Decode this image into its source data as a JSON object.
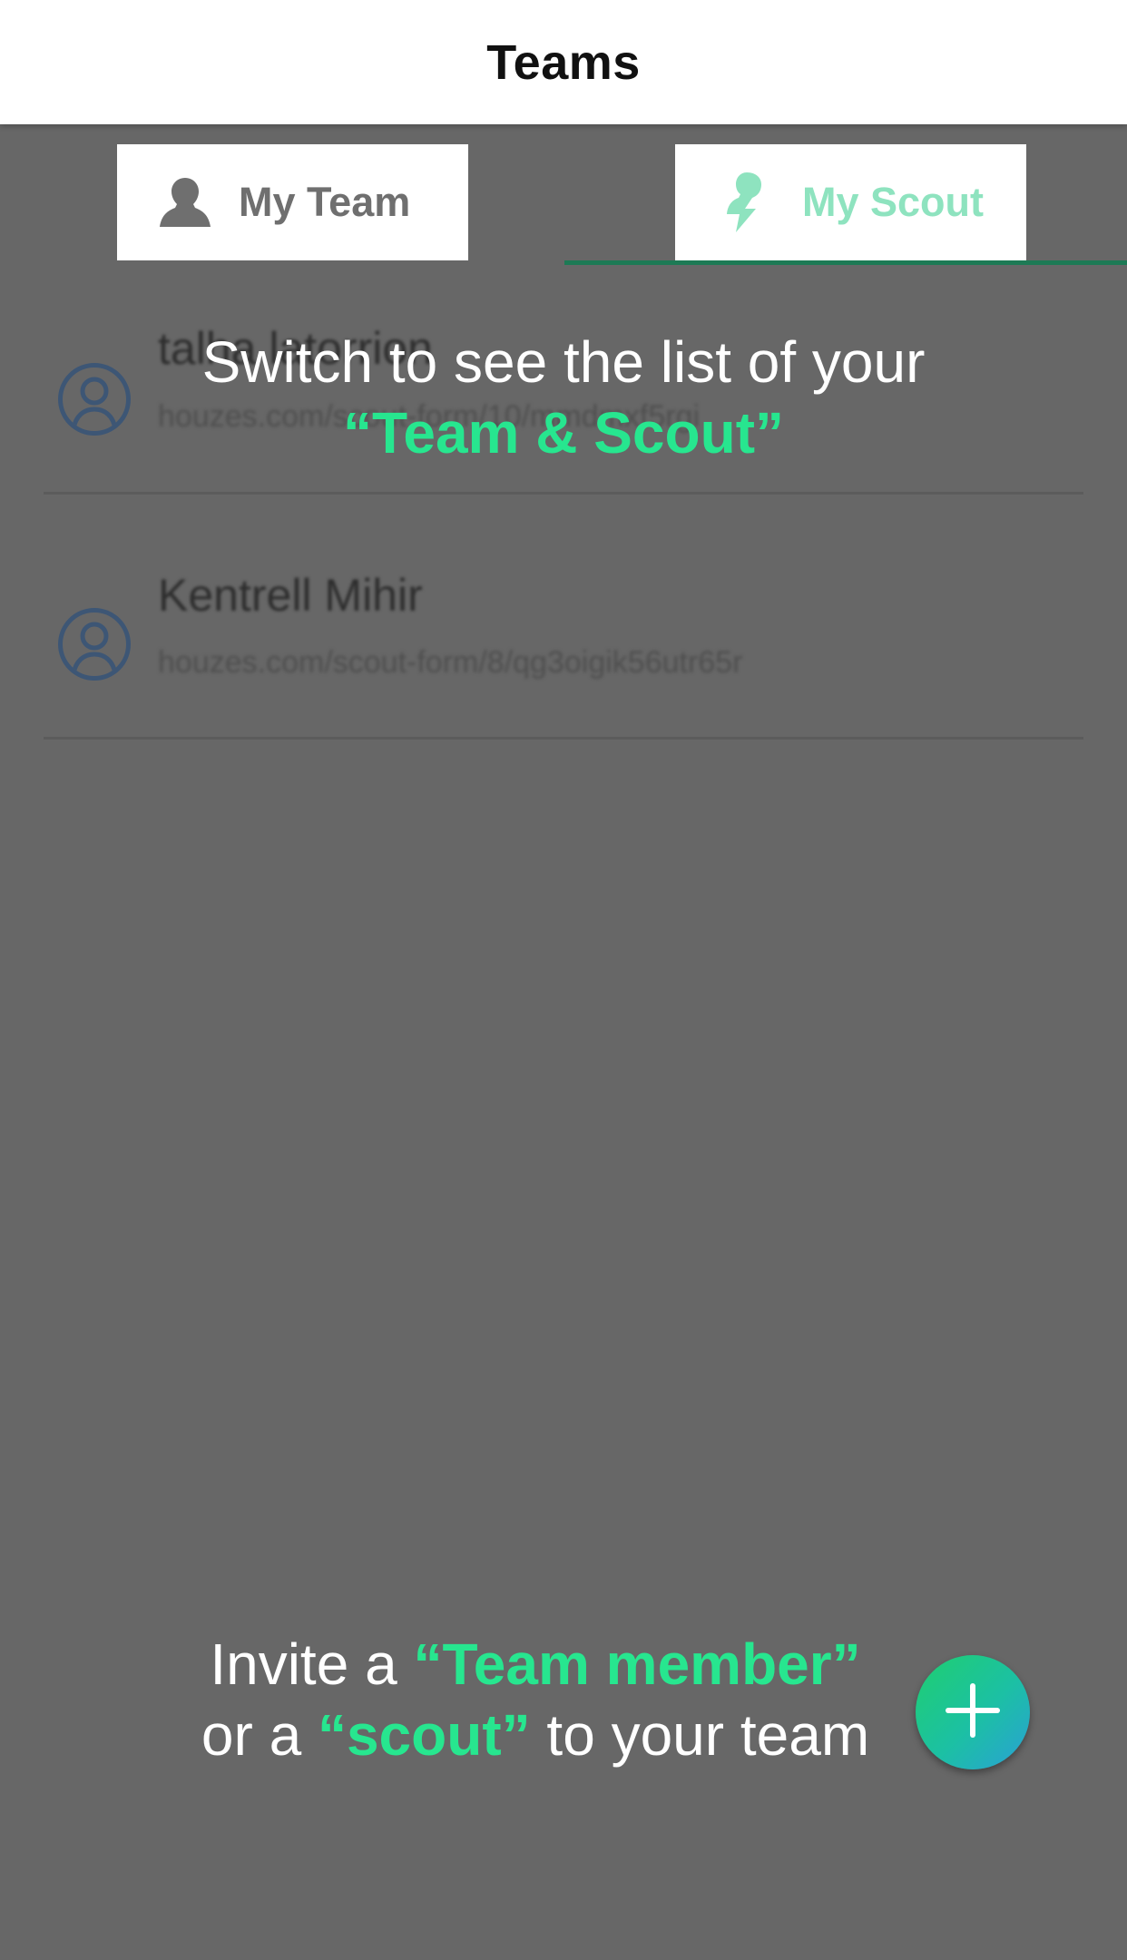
{
  "header": {
    "title": "Teams"
  },
  "tabs": [
    {
      "label": "My Team",
      "icon": "person-silhouette-icon",
      "color": "#6f6f6f"
    },
    {
      "label": "My Scout",
      "icon": "scout-person-icon",
      "color": "#8ee3bf"
    }
  ],
  "list": [
    {
      "name": "talha latorrion",
      "url": "houzes.com/scout-form/10/mmdmxf5rgi"
    },
    {
      "name": "Kentrell Mihir",
      "url": "houzes.com/scout-form/8/qg3oigik56utr65r"
    }
  ],
  "hints": {
    "switch_line1": "Switch to see the list of your",
    "switch_line2": "“Team &  Scout”",
    "invite_pre": "Invite a ",
    "invite_accent1": "“Team member”",
    "invite_mid": "or a ",
    "invite_accent2": "“scout”",
    "invite_post": " to your team"
  },
  "fab": {
    "icon": "plus-icon"
  },
  "colors": {
    "accent": "#27e68f",
    "overlay": "#676767",
    "tab_underline": "#1d7a55"
  }
}
